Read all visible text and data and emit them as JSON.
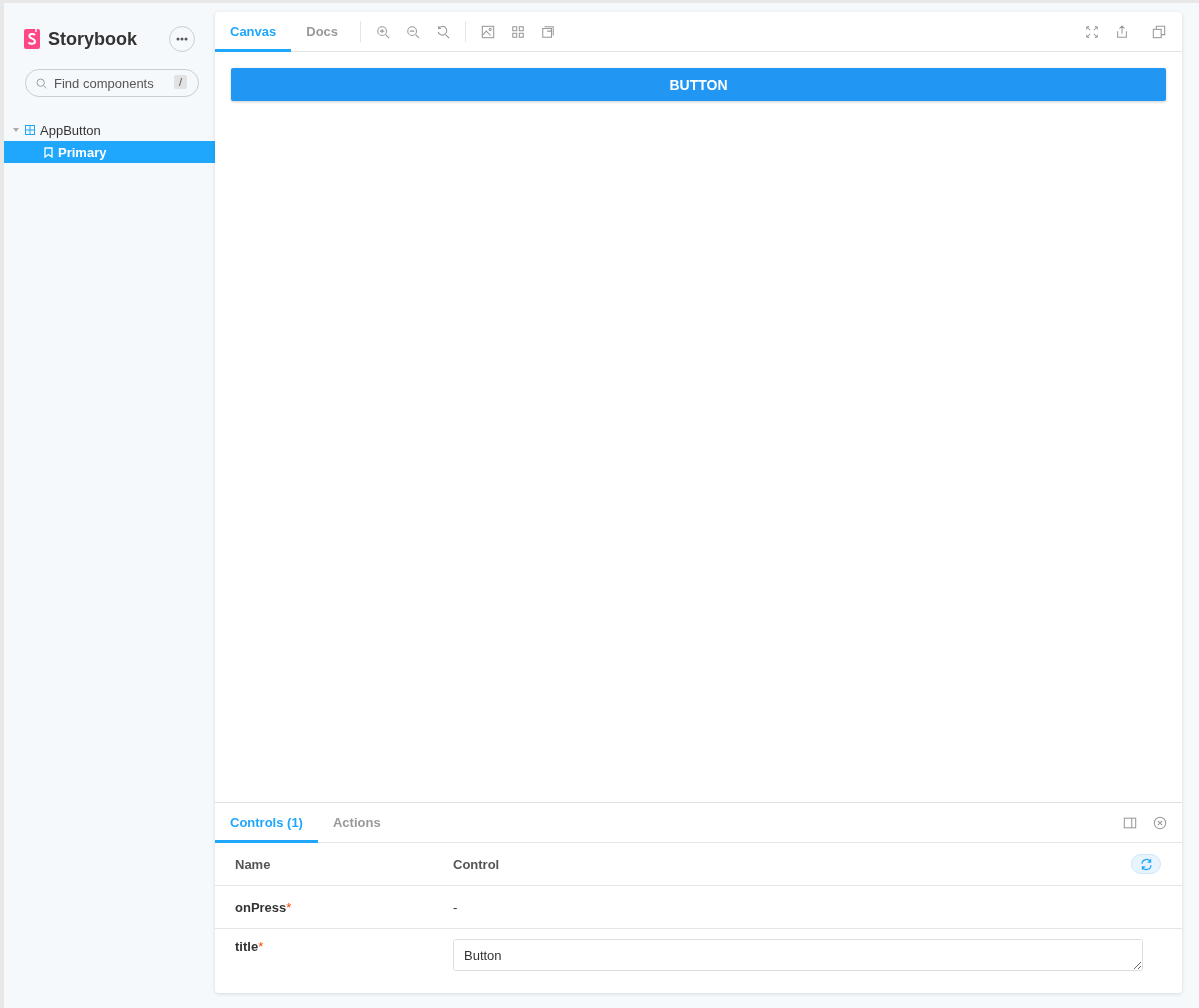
{
  "sidebar": {
    "brand": "Storybook",
    "search": {
      "placeholder": "Find components",
      "shortcut": "/"
    },
    "tree": [
      {
        "label": "AppButton",
        "kind": "component",
        "expanded": true,
        "selected": false,
        "children": [
          {
            "label": "Primary",
            "kind": "story",
            "selected": true
          }
        ]
      }
    ]
  },
  "toolbar": {
    "tabs": [
      {
        "label": "Canvas",
        "selected": true
      },
      {
        "label": "Docs",
        "selected": false
      }
    ]
  },
  "preview": {
    "button": "BUTTON"
  },
  "addons": {
    "tabs": [
      {
        "label": "Controls (1)",
        "selected": true
      },
      {
        "label": "Actions",
        "selected": false
      }
    ],
    "columns": [
      "Name",
      "Control"
    ],
    "rows": [
      {
        "name": "onPress",
        "required_mark": "*",
        "kind": "none",
        "value": "-"
      },
      {
        "name": "title",
        "required_mark": "*",
        "kind": "text",
        "value": "Button"
      }
    ]
  }
}
